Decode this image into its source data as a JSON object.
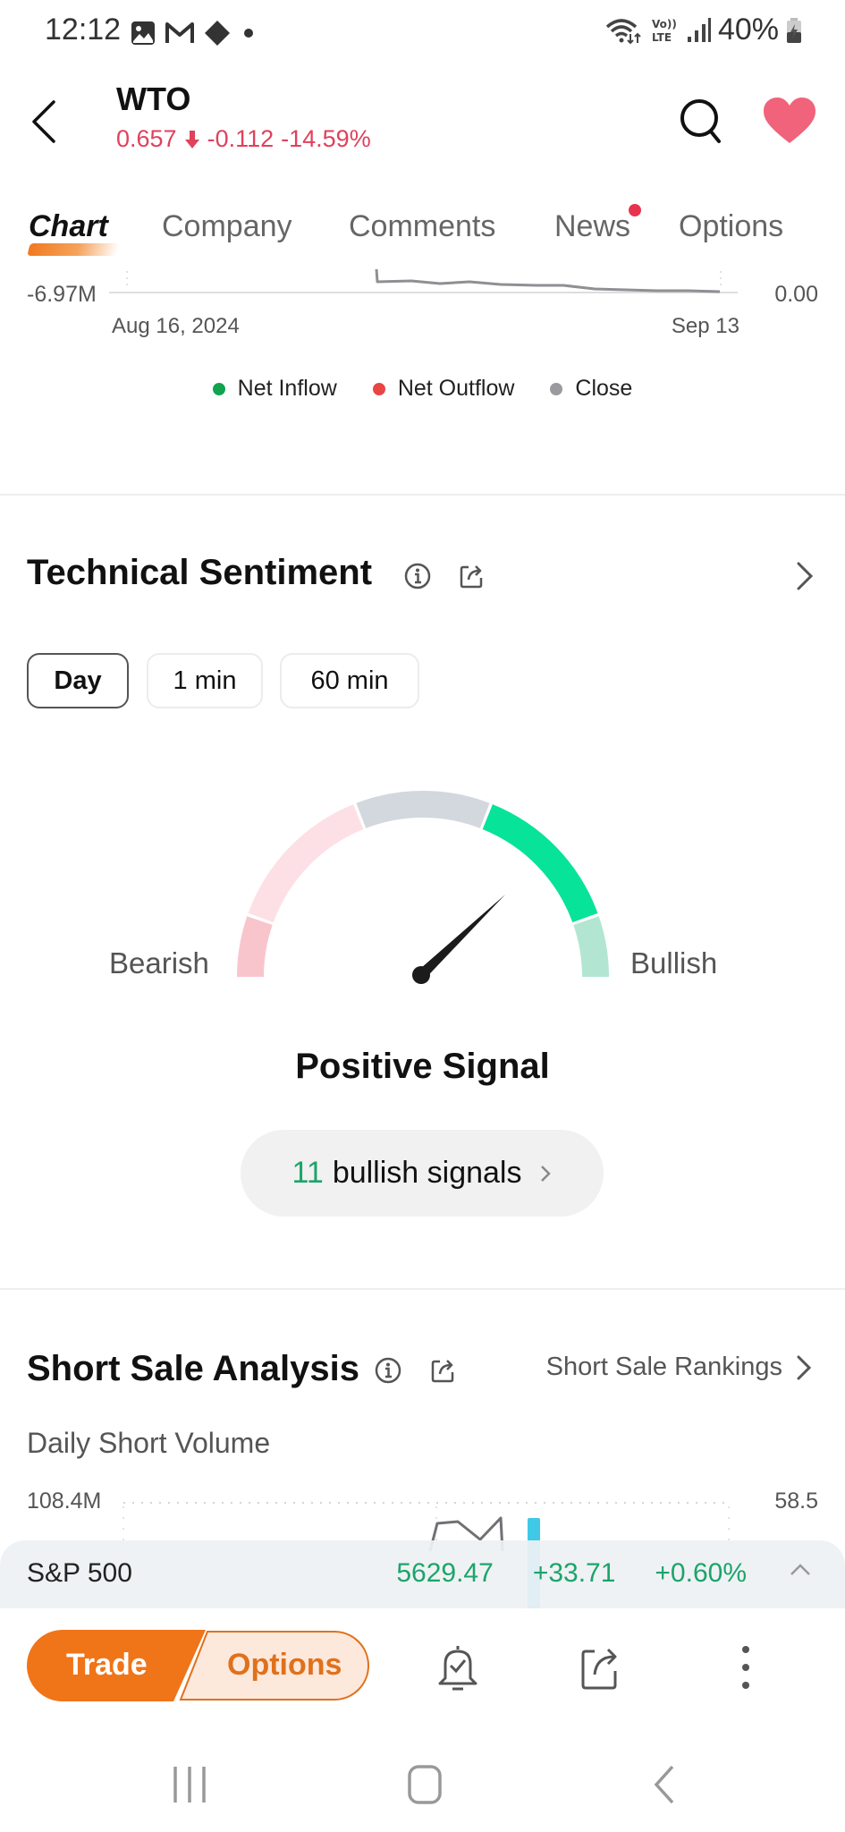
{
  "status_bar": {
    "time": "12:12",
    "left_icons": [
      "gallery-icon",
      "gmail-icon",
      "diamond-app-icon",
      "dot-icon"
    ],
    "right_icons": [
      "wifi-icon",
      "volte-icon",
      "signal-icon"
    ],
    "battery": "40%"
  },
  "header": {
    "ticker": "WTO",
    "price": "0.657",
    "change": "-0.112",
    "change_pct": "-14.59%",
    "direction": "down",
    "accent_color": "#e0415c"
  },
  "tabs": [
    {
      "label": "Chart",
      "active": true
    },
    {
      "label": "Company",
      "active": false
    },
    {
      "label": "Comments",
      "active": false
    },
    {
      "label": "News",
      "active": false,
      "badge": true
    },
    {
      "label": "Options",
      "active": false
    }
  ],
  "flow_chart": {
    "y_left_label": "-6.97M",
    "y_right_label": "0.00",
    "x_start_label": "Aug 16, 2024",
    "x_end_label": "Sep 13",
    "legend": [
      {
        "label": "Net Inflow",
        "color": "#13a350"
      },
      {
        "label": "Net Outflow",
        "color": "#e84545"
      },
      {
        "label": "Close",
        "color": "#9a9a9f"
      }
    ]
  },
  "technical_sentiment": {
    "title": "Technical Sentiment",
    "periods": [
      {
        "label": "Day",
        "active": true
      },
      {
        "label": "1 min",
        "active": false
      },
      {
        "label": "60 min",
        "active": false
      }
    ],
    "gauge": {
      "left_label": "Bearish",
      "right_label": "Bullish",
      "segments": [
        {
          "name": "strong-bearish",
          "color": "#f9c5cd"
        },
        {
          "name": "bearish",
          "color": "#fde0e5"
        },
        {
          "name": "neutral",
          "color": "#d3d7de"
        },
        {
          "name": "bullish",
          "color": "#08e39a"
        },
        {
          "name": "strong-bullish",
          "color": "#b2e6d2"
        }
      ],
      "needle_fraction": 0.75
    },
    "signal_title": "Positive Signal",
    "signal_count": "11",
    "signal_text": "bullish signals"
  },
  "short_sale": {
    "title": "Short Sale Analysis",
    "rankings_link": "Short Sale Rankings",
    "subtitle": "Daily Short Volume",
    "y_left_label": "108.4M",
    "y_right_label": "58.5"
  },
  "index_bar": {
    "name": "S&P 500",
    "value": "5629.47",
    "change": "+33.71",
    "change_pct": "+0.60%",
    "color": "#1ca46b"
  },
  "action_bar": {
    "trade_label": "Trade",
    "options_label": "Options",
    "brand_color": "#f07418"
  }
}
